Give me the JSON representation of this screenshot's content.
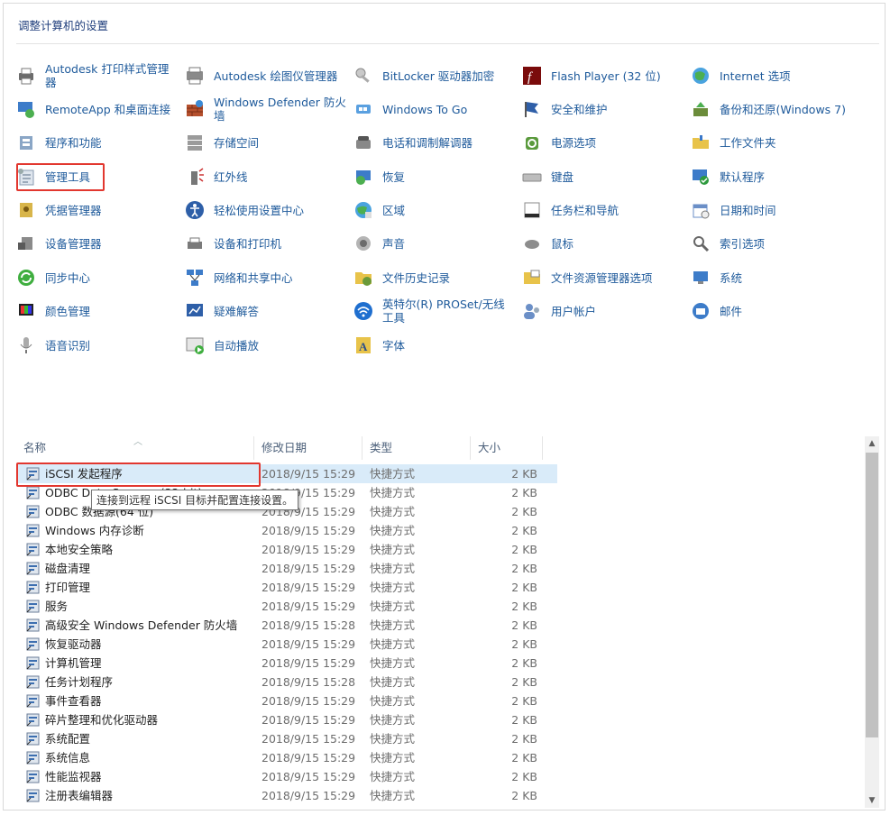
{
  "title": "调整计算机的设置",
  "items": [
    {
      "label": "Autodesk 打印样式管理器",
      "icon": "printer-icon"
    },
    {
      "label": "Autodesk 绘图仪管理器",
      "icon": "plotter-icon"
    },
    {
      "label": "BitLocker 驱动器加密",
      "icon": "bitlocker-key-icon"
    },
    {
      "label": "Flash Player (32 位)",
      "icon": "flash-icon"
    },
    {
      "label": "Internet 选项",
      "icon": "globe-icon"
    },
    {
      "label": "RemoteApp 和桌面连接",
      "icon": "remoteapp-icon"
    },
    {
      "label": "Windows Defender 防火墙",
      "icon": "firewall-icon"
    },
    {
      "label": "Windows To Go",
      "icon": "windows-to-go-icon"
    },
    {
      "label": "安全和维护",
      "icon": "flag-icon"
    },
    {
      "label": "备份和还原(Windows 7)",
      "icon": "backup-icon"
    },
    {
      "label": "程序和功能",
      "icon": "programs-icon"
    },
    {
      "label": "存储空间",
      "icon": "storage-icon"
    },
    {
      "label": "电话和调制解调器",
      "icon": "phone-icon"
    },
    {
      "label": "电源选项",
      "icon": "power-icon"
    },
    {
      "label": "工作文件夹",
      "icon": "work-folder-icon"
    },
    {
      "label": "管理工具",
      "icon": "admin-tools-icon"
    },
    {
      "label": "红外线",
      "icon": "infrared-icon"
    },
    {
      "label": "恢复",
      "icon": "recovery-icon"
    },
    {
      "label": "键盘",
      "icon": "keyboard-icon"
    },
    {
      "label": "默认程序",
      "icon": "default-programs-icon"
    },
    {
      "label": "凭据管理器",
      "icon": "credential-icon"
    },
    {
      "label": "轻松使用设置中心",
      "icon": "ease-of-access-icon"
    },
    {
      "label": "区域",
      "icon": "region-icon"
    },
    {
      "label": "任务栏和导航",
      "icon": "taskbar-icon"
    },
    {
      "label": "日期和时间",
      "icon": "calendar-icon"
    },
    {
      "label": "设备管理器",
      "icon": "device-manager-icon"
    },
    {
      "label": "设备和打印机",
      "icon": "devices-printers-icon"
    },
    {
      "label": "声音",
      "icon": "speaker-icon"
    },
    {
      "label": "鼠标",
      "icon": "mouse-icon"
    },
    {
      "label": "索引选项",
      "icon": "indexing-icon"
    },
    {
      "label": "同步中心",
      "icon": "sync-icon"
    },
    {
      "label": "网络和共享中心",
      "icon": "network-icon"
    },
    {
      "label": "文件历史记录",
      "icon": "file-history-icon"
    },
    {
      "label": "文件资源管理器选项",
      "icon": "folder-options-icon"
    },
    {
      "label": "系统",
      "icon": "system-icon"
    },
    {
      "label": "颜色管理",
      "icon": "color-management-icon"
    },
    {
      "label": "疑难解答",
      "icon": "troubleshoot-icon"
    },
    {
      "label": "英特尔(R) PROSet/无线工具",
      "icon": "wifi-icon"
    },
    {
      "label": "用户帐户",
      "icon": "user-accounts-icon"
    },
    {
      "label": "邮件",
      "icon": "mail-icon"
    },
    {
      "label": "语音识别",
      "icon": "microphone-icon"
    },
    {
      "label": "自动播放",
      "icon": "autoplay-icon"
    },
    {
      "label": "字体",
      "icon": "font-icon"
    }
  ],
  "list": {
    "columns": [
      "名称",
      "修改日期",
      "类型",
      "大小"
    ],
    "rows": [
      {
        "name": "iSCSI 发起程序",
        "date": "2018/9/15 15:29",
        "type": "快捷方式",
        "size": "2 KB"
      },
      {
        "name": "ODBC Data Sources (32-bit)",
        "date": "2018/9/15 15:29",
        "type": "快捷方式",
        "size": "2 KB"
      },
      {
        "name": "ODBC 数据源(64 位)",
        "date": "2018/9/15 15:29",
        "type": "快捷方式",
        "size": "2 KB"
      },
      {
        "name": "Windows 内存诊断",
        "date": "2018/9/15 15:29",
        "type": "快捷方式",
        "size": "2 KB"
      },
      {
        "name": "本地安全策略",
        "date": "2018/9/15 15:29",
        "type": "快捷方式",
        "size": "2 KB"
      },
      {
        "name": "磁盘清理",
        "date": "2018/9/15 15:29",
        "type": "快捷方式",
        "size": "2 KB"
      },
      {
        "name": "打印管理",
        "date": "2018/9/15 15:29",
        "type": "快捷方式",
        "size": "2 KB"
      },
      {
        "name": "服务",
        "date": "2018/9/15 15:29",
        "type": "快捷方式",
        "size": "2 KB"
      },
      {
        "name": "高级安全 Windows Defender 防火墙",
        "date": "2018/9/15 15:28",
        "type": "快捷方式",
        "size": "2 KB"
      },
      {
        "name": "恢复驱动器",
        "date": "2018/9/15 15:29",
        "type": "快捷方式",
        "size": "2 KB"
      },
      {
        "name": "计算机管理",
        "date": "2018/9/15 15:29",
        "type": "快捷方式",
        "size": "2 KB"
      },
      {
        "name": "任务计划程序",
        "date": "2018/9/15 15:28",
        "type": "快捷方式",
        "size": "2 KB"
      },
      {
        "name": "事件查看器",
        "date": "2018/9/15 15:29",
        "type": "快捷方式",
        "size": "2 KB"
      },
      {
        "name": "碎片整理和优化驱动器",
        "date": "2018/9/15 15:29",
        "type": "快捷方式",
        "size": "2 KB"
      },
      {
        "name": "系统配置",
        "date": "2018/9/15 15:29",
        "type": "快捷方式",
        "size": "2 KB"
      },
      {
        "name": "系统信息",
        "date": "2018/9/15 15:29",
        "type": "快捷方式",
        "size": "2 KB"
      },
      {
        "name": "性能监视器",
        "date": "2018/9/15 15:29",
        "type": "快捷方式",
        "size": "2 KB"
      },
      {
        "name": "注册表编辑器",
        "date": "2018/9/15 15:29",
        "type": "快捷方式",
        "size": "2 KB"
      }
    ]
  },
  "tooltip": "连接到远程 iSCSI 目标并配置连接设置。",
  "colors": {
    "link": "#1e5a9b",
    "highlight": "#e2372f",
    "selected_row": "#d9ebf9"
  }
}
